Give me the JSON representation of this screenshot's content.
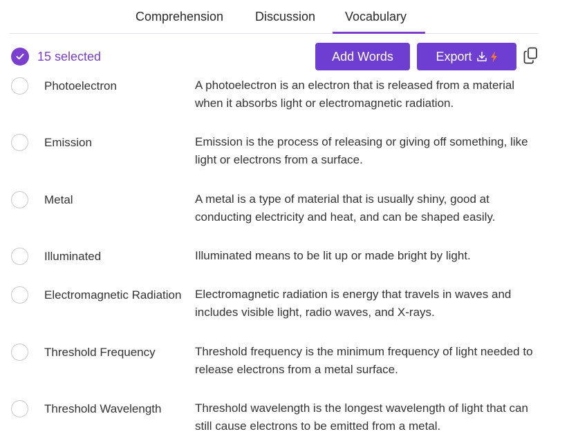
{
  "tabs": [
    {
      "label": "Comprehension"
    },
    {
      "label": "Discussion"
    },
    {
      "label": "Vocabulary"
    }
  ],
  "active_tab": "Vocabulary",
  "selection": {
    "label": "15 selected"
  },
  "toolbar": {
    "add_label": "Add Words",
    "export_label": "Export"
  },
  "colors": {
    "accent": "#7a3fcf",
    "button": "#6e3dd1",
    "bolt": "#f4743b"
  },
  "words": [
    {
      "term": "Photoelectron",
      "definition": "A photoelectron is an electron that is released from a material when it absorbs light or electromagnetic radiation."
    },
    {
      "term": "Emission",
      "definition": "Emission is the process of releasing or giving off something, like light or electrons from a surface."
    },
    {
      "term": "Metal",
      "definition": "A metal is a type of material that is usually shiny, good at conducting electricity and heat, and can be shaped easily."
    },
    {
      "term": "Illuminated",
      "definition": "Illuminated means to be lit up or made bright by light."
    },
    {
      "term": "Electromagnetic Radiation",
      "definition": "Electromagnetic radiation is energy that travels in waves and includes visible light, radio waves, and X-rays."
    },
    {
      "term": "Threshold Frequency",
      "definition": "Threshold frequency is the minimum frequency of light needed to release electrons from a metal surface."
    },
    {
      "term": "Threshold Wavelength",
      "definition": "Threshold wavelength is the longest wavelength of light that can still cause electrons to be emitted from a metal."
    }
  ]
}
